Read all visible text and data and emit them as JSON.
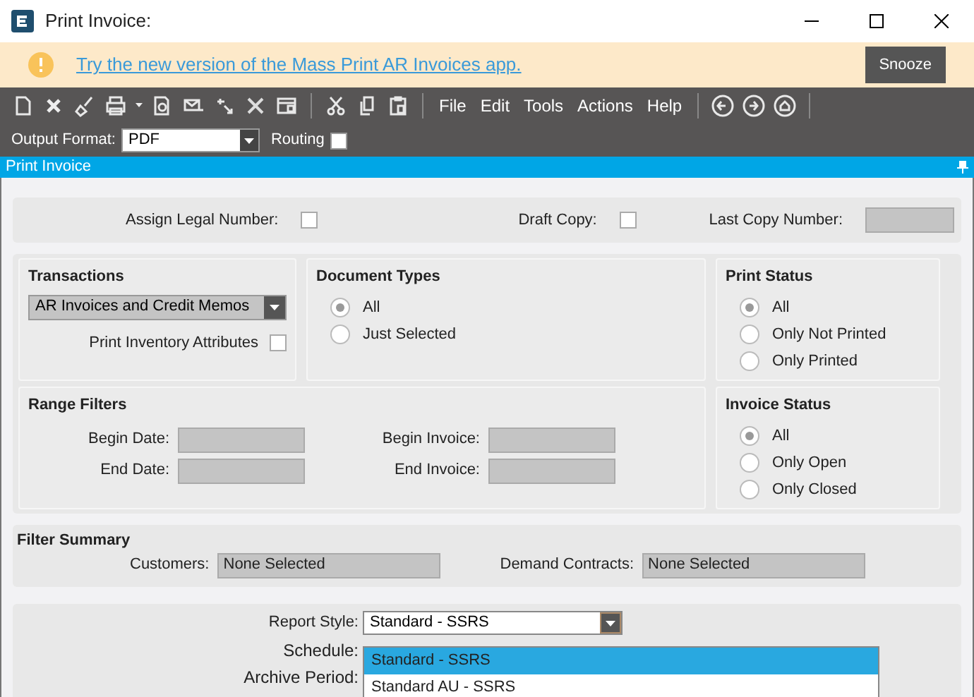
{
  "window": {
    "title": "Print Invoice:"
  },
  "banner": {
    "link": "Try the new version of the Mass Print AR Invoices app.",
    "button": "Snooze"
  },
  "menus": [
    "File",
    "Edit",
    "Tools",
    "Actions",
    "Help"
  ],
  "output_format": {
    "label": "Output Format:",
    "value": "PDF"
  },
  "routing": {
    "label": "Routing",
    "checked": false
  },
  "panel_title": "Print Invoice",
  "assign_legal_number": {
    "label": "Assign Legal Number:",
    "checked": false
  },
  "draft_copy": {
    "label": "Draft Copy:",
    "checked": false
  },
  "last_copy_number": {
    "label": "Last Copy Number:"
  },
  "transactions": {
    "title": "Transactions",
    "value": "AR Invoices and Credit Memos",
    "print_inventory_attributes": {
      "label": "Print Inventory Attributes",
      "checked": false
    }
  },
  "document_types": {
    "title": "Document Types",
    "options": [
      {
        "label": "All",
        "selected": true
      },
      {
        "label": "Just Selected",
        "selected": false
      }
    ]
  },
  "print_status": {
    "title": "Print Status",
    "options": [
      {
        "label": "All",
        "selected": true
      },
      {
        "label": "Only Not Printed",
        "selected": false
      },
      {
        "label": "Only Printed",
        "selected": false
      }
    ]
  },
  "range_filters": {
    "title": "Range Filters",
    "fields": [
      {
        "label": "Begin Date:"
      },
      {
        "label": "Begin Invoice:"
      },
      {
        "label": "End Date:"
      },
      {
        "label": "End Invoice:"
      }
    ]
  },
  "invoice_status": {
    "title": "Invoice Status",
    "options": [
      {
        "label": "All",
        "selected": true
      },
      {
        "label": "Only Open",
        "selected": false
      },
      {
        "label": "Only Closed",
        "selected": false
      }
    ]
  },
  "filter_summary": {
    "title": "Filter Summary",
    "customers": {
      "label": "Customers:",
      "value": "None Selected"
    },
    "demand_contracts": {
      "label": "Demand Contracts:",
      "value": "None Selected"
    }
  },
  "report_style": {
    "label": "Report Style:",
    "value": "Standard - SSRS",
    "options": [
      {
        "label": "Standard - SSRS",
        "selected": true
      },
      {
        "label": "Standard AU - SSRS",
        "selected": false
      }
    ]
  },
  "schedule": {
    "label": "Schedule:"
  },
  "archive_period": {
    "label": "Archive Period:"
  }
}
